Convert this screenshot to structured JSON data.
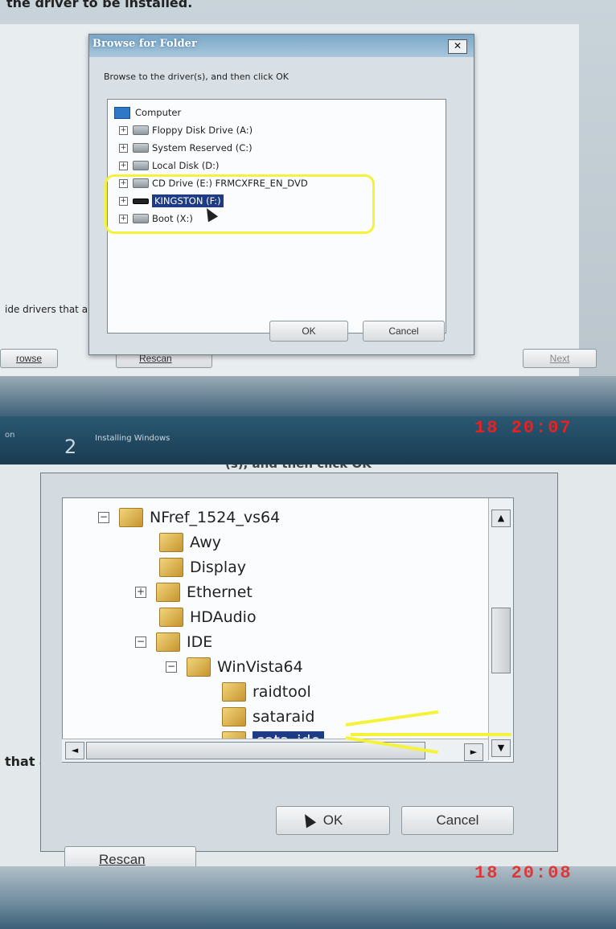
{
  "top": {
    "cut_text": "the driver to be installed.",
    "left_cut_text": "ide drivers that a",
    "browse_btn": "rowse",
    "rescan_btn": "Rescan",
    "next_btn": "Next",
    "dialog": {
      "title": "Browse for Folder",
      "close": "✕",
      "instruction": "Browse to the driver(s), and then click OK",
      "tree": [
        {
          "label": "Computer",
          "expander": "",
          "icon": "computer-icon"
        },
        {
          "label": "Floppy Disk Drive (A:)",
          "expander": "+",
          "icon": "floppy-drive-icon"
        },
        {
          "label": "System Reserved (C:)",
          "expander": "+",
          "icon": "hard-drive-icon"
        },
        {
          "label": "Local Disk (D:)",
          "expander": "+",
          "icon": "hard-drive-icon"
        },
        {
          "label": "CD Drive (E:) FRMCXFRE_EN_DVD",
          "expander": "+",
          "icon": "cd-drive-icon"
        },
        {
          "label": "KINGSTON (F:)",
          "expander": "+",
          "icon": "usb-drive-icon",
          "selected": true
        },
        {
          "label": "Boot (X:)",
          "expander": "+",
          "icon": "hard-drive-icon"
        }
      ],
      "ok": "OK",
      "cancel": "Cancel"
    },
    "step_number": "2",
    "step_label": "Installing Windows",
    "left_step_cut": "on",
    "timestamp": "18  20:07",
    "colors": {
      "highlight": "#f5f23a",
      "stamp": "#e82222",
      "selection": "#1e3c86"
    }
  },
  "bottom": {
    "cut_header": "(s), and then click OK",
    "left_cut_text": "that a",
    "rescan_btn": "Rescan",
    "tree": [
      {
        "label": "NFref_1524_vs64",
        "expander": "−"
      },
      {
        "label": "Awy",
        "expander": ""
      },
      {
        "label": "Display",
        "expander": ""
      },
      {
        "label": "Ethernet",
        "expander": "+"
      },
      {
        "label": "HDAudio",
        "expander": ""
      },
      {
        "label": "IDE",
        "expander": "−"
      },
      {
        "label": "WinVista64",
        "expander": "−"
      },
      {
        "label": "raidtool",
        "expander": ""
      },
      {
        "label": "sataraid",
        "expander": ""
      },
      {
        "label": "sata_ide",
        "expander": "",
        "selected": true
      }
    ],
    "scroll_up": "▲",
    "scroll_down": "▼",
    "scroll_left": "◄",
    "scroll_right": "►",
    "ok": "OK",
    "cancel": "Cancel",
    "timestamp": "18  20:08"
  }
}
